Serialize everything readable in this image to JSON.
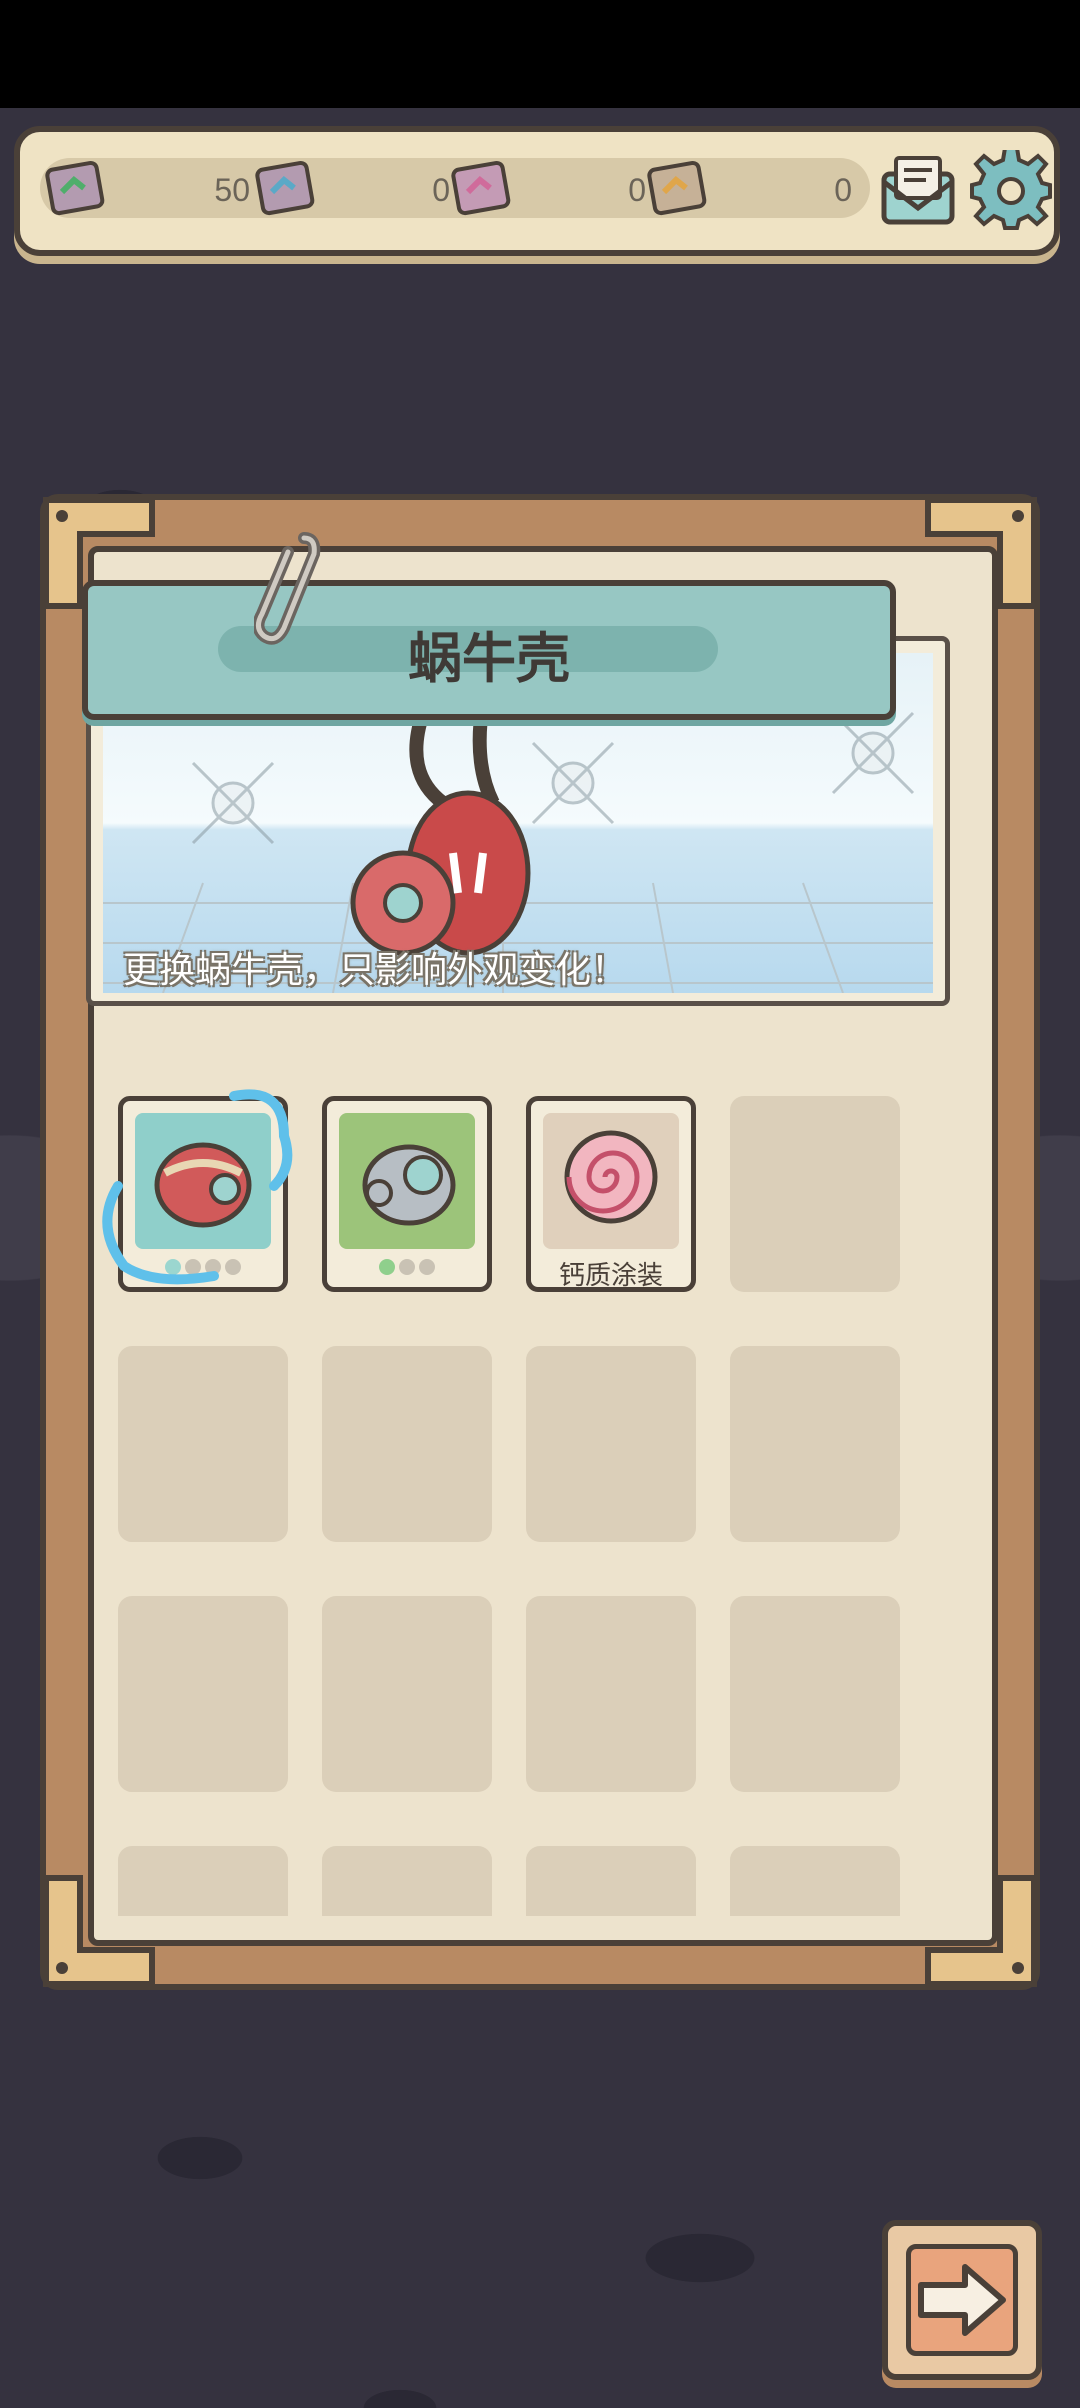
{
  "resources": [
    {
      "icon": "ticket-icon",
      "value": "50"
    },
    {
      "icon": "ticket-icon",
      "value": "0"
    },
    {
      "icon": "ticket-icon",
      "value": "0"
    },
    {
      "icon": "ticket-icon",
      "value": "0"
    }
  ],
  "toolbar": {
    "mail_icon": "mail-icon",
    "settings_icon": "gear-icon"
  },
  "panel": {
    "title": "蜗牛壳",
    "description": "更换蜗牛壳，只影响外观变化！"
  },
  "items": [
    {
      "name": "red-shell",
      "selected": true,
      "level_dots": 4,
      "level_filled": 1
    },
    {
      "name": "steel-shell",
      "selected": false,
      "level_dots": 3,
      "level_filled": 1
    },
    {
      "name": "calcium-coating",
      "label": "钙质涂装"
    }
  ],
  "colors": {
    "accent_teal": "#97c7c3",
    "panel_wood": "#b88a63",
    "paper": "#ede3cd"
  }
}
